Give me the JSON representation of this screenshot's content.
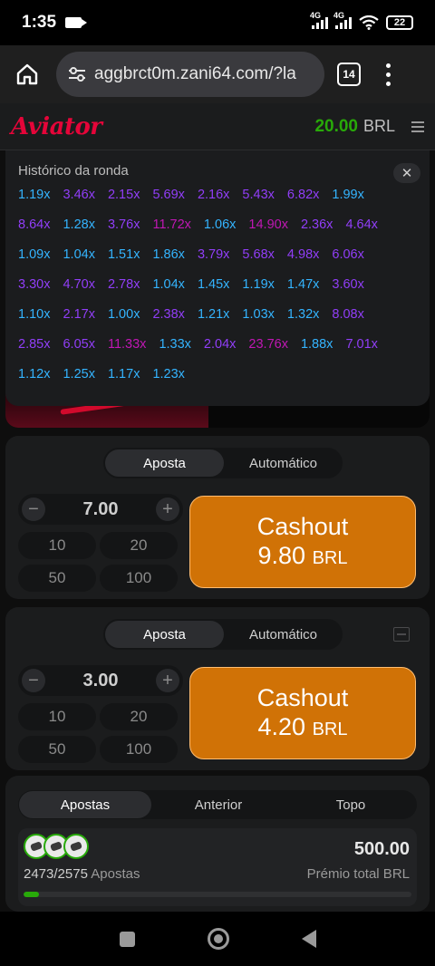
{
  "statusbar": {
    "time": "1:35",
    "net1": "4G",
    "net2": "4G",
    "battery": "22"
  },
  "browser": {
    "url": "aggbrct0m.zani64.com/?la",
    "tab_count": "14"
  },
  "header": {
    "logo": "Aviator",
    "balance_amount": "20.00",
    "balance_currency": "BRL"
  },
  "history": {
    "title": "Histórico da ronda",
    "close": "✕",
    "multipliers": [
      {
        "v": "1.19x",
        "c": "blue"
      },
      {
        "v": "3.46x",
        "c": "purple"
      },
      {
        "v": "2.15x",
        "c": "purple"
      },
      {
        "v": "5.69x",
        "c": "purple"
      },
      {
        "v": "2.16x",
        "c": "purple"
      },
      {
        "v": "5.43x",
        "c": "purple"
      },
      {
        "v": "6.82x",
        "c": "purple"
      },
      {
        "v": "1.99x",
        "c": "blue"
      },
      {
        "v": "8.64x",
        "c": "purple"
      },
      {
        "v": "1.28x",
        "c": "blue"
      },
      {
        "v": "3.76x",
        "c": "purple"
      },
      {
        "v": "11.72x",
        "c": "pink"
      },
      {
        "v": "1.06x",
        "c": "blue"
      },
      {
        "v": "14.90x",
        "c": "pink"
      },
      {
        "v": "2.36x",
        "c": "purple"
      },
      {
        "v": "4.64x",
        "c": "purple"
      },
      {
        "v": "1.09x",
        "c": "blue"
      },
      {
        "v": "1.04x",
        "c": "blue"
      },
      {
        "v": "1.51x",
        "c": "blue"
      },
      {
        "v": "1.86x",
        "c": "blue"
      },
      {
        "v": "3.79x",
        "c": "purple"
      },
      {
        "v": "5.68x",
        "c": "purple"
      },
      {
        "v": "4.98x",
        "c": "purple"
      },
      {
        "v": "6.06x",
        "c": "purple"
      },
      {
        "v": "3.30x",
        "c": "purple"
      },
      {
        "v": "4.70x",
        "c": "purple"
      },
      {
        "v": "2.78x",
        "c": "purple"
      },
      {
        "v": "1.04x",
        "c": "blue"
      },
      {
        "v": "1.45x",
        "c": "blue"
      },
      {
        "v": "1.19x",
        "c": "blue"
      },
      {
        "v": "1.47x",
        "c": "blue"
      },
      {
        "v": "3.60x",
        "c": "purple"
      },
      {
        "v": "1.10x",
        "c": "blue"
      },
      {
        "v": "2.17x",
        "c": "purple"
      },
      {
        "v": "1.00x",
        "c": "blue"
      },
      {
        "v": "2.38x",
        "c": "purple"
      },
      {
        "v": "1.21x",
        "c": "blue"
      },
      {
        "v": "1.03x",
        "c": "blue"
      },
      {
        "v": "1.32x",
        "c": "blue"
      },
      {
        "v": "8.08x",
        "c": "purple"
      },
      {
        "v": "2.85x",
        "c": "purple"
      },
      {
        "v": "6.05x",
        "c": "purple"
      },
      {
        "v": "11.33x",
        "c": "pink"
      },
      {
        "v": "1.33x",
        "c": "blue"
      },
      {
        "v": "2.04x",
        "c": "purple"
      },
      {
        "v": "23.76x",
        "c": "pink"
      },
      {
        "v": "1.88x",
        "c": "blue"
      },
      {
        "v": "7.01x",
        "c": "purple"
      },
      {
        "v": "1.12x",
        "c": "blue"
      },
      {
        "v": "1.25x",
        "c": "blue"
      },
      {
        "v": "1.17x",
        "c": "blue"
      },
      {
        "v": "1.23x",
        "c": "blue"
      }
    ]
  },
  "bet1": {
    "tab_bet": "Aposta",
    "tab_auto": "Automático",
    "minus": "−",
    "plus": "+",
    "amount": "7.00",
    "quick": [
      "10",
      "20",
      "50",
      "100"
    ],
    "cashout_label": "Cashout",
    "cashout_amount": "9.80",
    "cashout_currency": "BRL"
  },
  "bet2": {
    "tab_bet": "Aposta",
    "tab_auto": "Automático",
    "minus": "−",
    "plus": "+",
    "amount": "3.00",
    "quick": [
      "10",
      "20",
      "50",
      "100"
    ],
    "cashout_label": "Cashout",
    "cashout_amount": "4.20",
    "cashout_currency": "BRL"
  },
  "bets": {
    "tabs": [
      "Apostas",
      "Anterior",
      "Topo"
    ],
    "count": "2473/2575",
    "count_label": "Apostas",
    "prize": "500.00",
    "prize_label": "Prémio total BRL",
    "progress_fraction": 0.04
  },
  "colors": {
    "accent_red": "#e50539",
    "balance_green": "#28a909",
    "cashout_orange": "#d07206",
    "mult_blue": "#34b4ff",
    "mult_purple": "#913ef8",
    "mult_pink": "#c017b4"
  }
}
